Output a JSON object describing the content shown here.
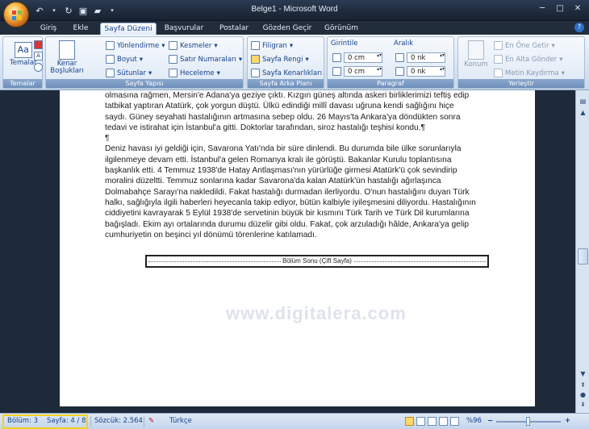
{
  "window": {
    "title": "Belge1 - Microsoft Word"
  },
  "tabs": [
    {
      "label": "Giriş"
    },
    {
      "label": "Ekle"
    },
    {
      "label": "Sayfa Düzeni",
      "active": true
    },
    {
      "label": "Başvurular"
    },
    {
      "label": "Postalar"
    },
    {
      "label": "Gözden Geçir"
    },
    {
      "label": "Görünüm"
    }
  ],
  "ribbon": {
    "temalar": {
      "label": "Temalar",
      "button": "Temalar"
    },
    "sayfa_yapisi": {
      "label": "Sayfa Yapısı",
      "kenar": "Kenar Boşlukları",
      "yonlendirme": "Yönlendirme",
      "boyut": "Boyut",
      "sutunlar": "Sütunlar",
      "kesmeler": "Kesmeler",
      "satir_numaralari": "Satır Numaraları",
      "heceleme": "Heceleme"
    },
    "sayfa_arka_plani": {
      "label": "Sayfa Arka Planı",
      "filigran": "Filigran",
      "sayfa_rengi": "Sayfa Rengi",
      "sayfa_kenarliklari": "Sayfa Kenarlıkları"
    },
    "paragraf": {
      "label": "Paragraf",
      "girintile": "Girintile",
      "aralik": "Aralık",
      "sol_girinti": "0 cm",
      "sag_girinti": "0 cm",
      "once": "0 nk",
      "sonra": "0 nk"
    },
    "yerlestir": {
      "label": "Yerleştir",
      "konum": "Konum",
      "en_one": "En Öne Getir",
      "en_alta": "En Alta Gönder",
      "metin_kaydirma": "Metin Kaydırma"
    }
  },
  "document": {
    "paragraphs": [
      "olmasına rağmen, Mersin'e Adana'ya geziye çıktı. Kızgın güneş altında askeri birliklerimizi teftiş edip tatbikat yaptıran Atatürk, çok yorgun düştü. Ülkü edindiği millî davası uğruna kendi sağlığını hiçe saydı. Güney seyahati hastalığının artmasına sebep oldu. 26 Mayıs'ta Ankara'ya döndükten sonra tedavi ve istirahat için İstanbul'a gitti. Doktorlar tarafından, siroz hastalığı teşhisi kondu.¶",
      "¶",
      "Deniz havası iyi geldiği için, Savarona Yatı'nda bir süre dinlendi. Bu durumda bile ülke sorunlarıyla ilgilenmeye devam etti. İstanbul'a gelen Romanya kralı ile görüştü. Bakanlar Kurulu toplantısına başkanlık etti. 4 Temmuz 1938'de Hatay Antlaşması'nın yürürlüğe girmesi Atatürk'ü çok sevindirip moralini düzeltti. Temmuz sonlarına kadar Savarona'da kalan Atatürk'ün hastalığı ağırlaşınca Dolmabahçe Sarayı'na nakledildi. Fakat hastalığı durmadan ilerliyordu. O'nun hastalığını duyan Türk halkı, sağlığıyla ilgili haberleri heyecanla takip ediyor, bütün kalbiyle iyileşmesini diliyordu. Hastalığının ciddiyetini kavrayarak 5 Eylül 1938'de servetinin büyük bir kısmını Türk Tarih ve Türk Dil kurumlarına bağışladı. Ekim ayı ortalarında durumu düzelir gibi oldu. Fakat, çok arzuladığı hâlde, Ankara'ya gelip cumhuriyetin on beşinci yıl dönümü törenlerine katılamadı."
    ],
    "section_break": "Bölüm Sonu (Çift Sayfa)",
    "watermark": "www.digitalera.com"
  },
  "statusbar": {
    "bolum": "Bölüm: 3",
    "sayfa": "Sayfa: 4 / 8",
    "sozcuk": "Sözcük: 2.564",
    "dil": "Türkçe",
    "zoom": "%96"
  }
}
